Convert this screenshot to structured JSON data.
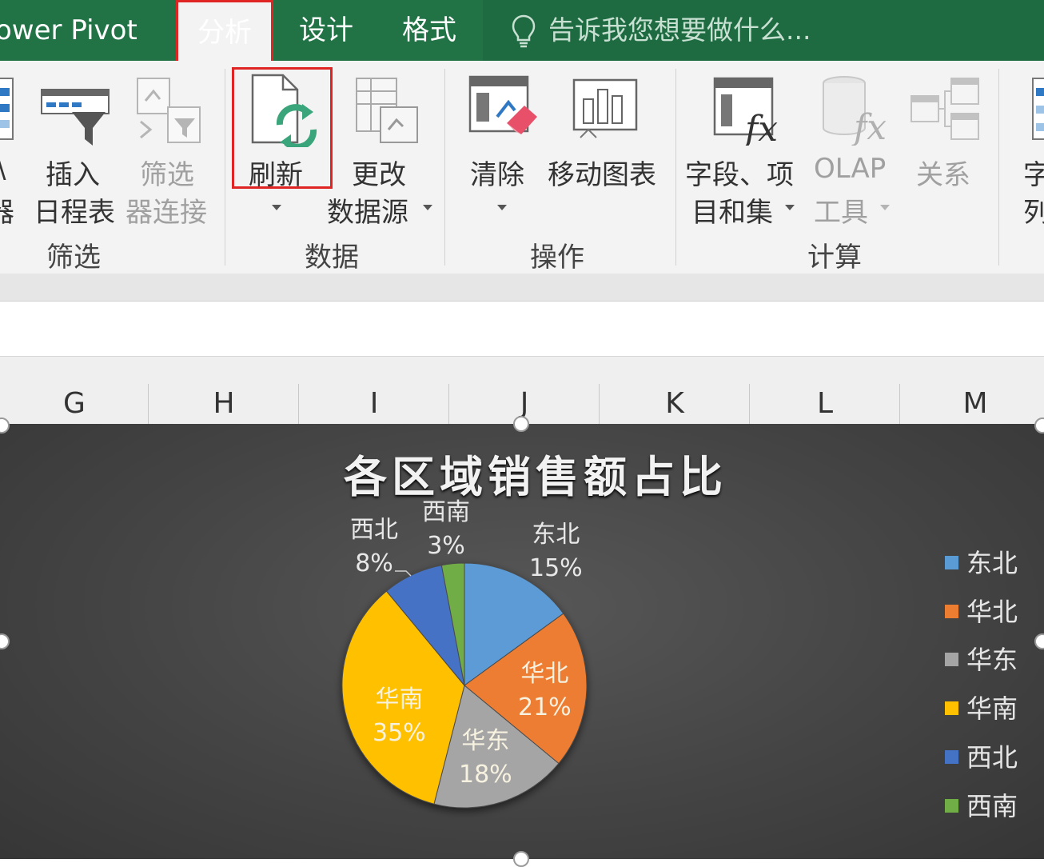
{
  "tabs": {
    "power_pivot": "ower Pivot",
    "analyze": "分析",
    "design": "设计",
    "format": "格式",
    "tell_me": "告诉我您想要做什么..."
  },
  "ribbon": {
    "filter_group": {
      "slicer_line1": "\\",
      "slicer_line2": "器",
      "timeline_line1": "插入",
      "timeline_line2": "日程表",
      "connections_line1": "筛选",
      "connections_line2": "器连接",
      "label": "筛选"
    },
    "data_group": {
      "refresh": "刷新",
      "change_source_line1": "更改",
      "change_source_line2": "数据源",
      "label": "数据"
    },
    "actions_group": {
      "clear": "清除",
      "move_chart": "移动图表",
      "label": "操作"
    },
    "calc_group": {
      "fields_line1": "字段、项",
      "fields_line2": "目和集",
      "olap_line1": "OLAP",
      "olap_line2": "工具",
      "relationships": "关系",
      "label": "计算"
    },
    "show_group": {
      "line1": "字",
      "line2": "列"
    }
  },
  "columns": [
    "G",
    "H",
    "I",
    "J",
    "K",
    "L",
    "M"
  ],
  "chart_data": {
    "type": "pie",
    "title": "各区域销售额占比",
    "slices": [
      {
        "name": "东北",
        "value": 15,
        "label": "15%",
        "color": "#5b9bd5"
      },
      {
        "name": "华北",
        "value": 21,
        "label": "21%",
        "color": "#ed7d31"
      },
      {
        "name": "华东",
        "value": 18,
        "label": "18%",
        "color": "#a5a5a5"
      },
      {
        "name": "华南",
        "value": 35,
        "label": "35%",
        "color": "#ffc000"
      },
      {
        "name": "西北",
        "value": 8,
        "label": "8%",
        "color": "#4472c4"
      },
      {
        "name": "西南",
        "value": 3,
        "label": "3%",
        "color": "#70ad47"
      }
    ],
    "legend_position": "right"
  },
  "colors": {
    "excel_green": "#217346",
    "highlight_red": "#e02424"
  }
}
